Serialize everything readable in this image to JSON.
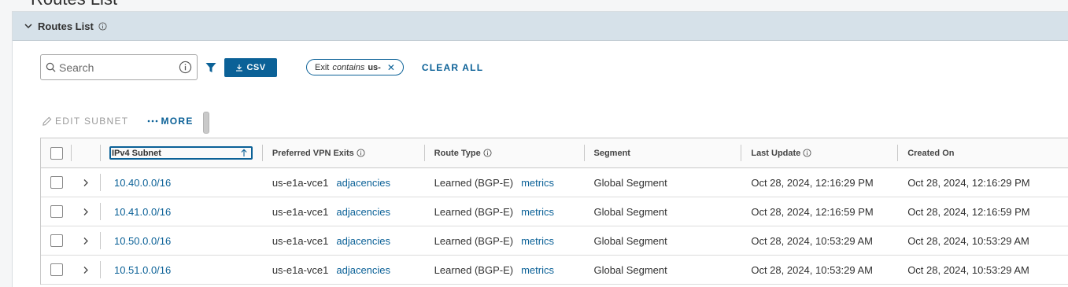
{
  "page": {
    "title": "Routes List"
  },
  "panel": {
    "title": "Routes List"
  },
  "toolbar": {
    "search_placeholder": "Search",
    "csv_label": "CSV",
    "filter_chip": {
      "field": "Exit",
      "operator": "contains",
      "value": "us-"
    },
    "clear_all_label": "CLEAR ALL"
  },
  "actions": {
    "edit_subnet_label": "EDIT SUBNET",
    "more_label": "MORE"
  },
  "table": {
    "columns": {
      "subnet": "IPv4 Subnet",
      "vpn": "Preferred VPN Exits",
      "type": "Route Type",
      "segment": "Segment",
      "updated": "Last Update",
      "created": "Created On"
    },
    "rows": [
      {
        "subnet": "10.40.0.0/16",
        "vpn": "us-e1a-vce1",
        "vpn_link": "adjacencies",
        "type": "Learned (BGP-E)",
        "type_link": "metrics",
        "segment": "Global Segment",
        "updated": "Oct 28, 2024, 12:16:29 PM",
        "created": "Oct 28, 2024, 12:16:29 PM"
      },
      {
        "subnet": "10.41.0.0/16",
        "vpn": "us-e1a-vce1",
        "vpn_link": "adjacencies",
        "type": "Learned (BGP-E)",
        "type_link": "metrics",
        "segment": "Global Segment",
        "updated": "Oct 28, 2024, 12:16:59 PM",
        "created": "Oct 28, 2024, 12:16:59 PM"
      },
      {
        "subnet": "10.50.0.0/16",
        "vpn": "us-e1a-vce1",
        "vpn_link": "adjacencies",
        "type": "Learned (BGP-E)",
        "type_link": "metrics",
        "segment": "Global Segment",
        "updated": "Oct 28, 2024, 10:53:29 AM",
        "created": "Oct 28, 2024, 10:53:29 AM"
      },
      {
        "subnet": "10.51.0.0/16",
        "vpn": "us-e1a-vce1",
        "vpn_link": "adjacencies",
        "type": "Learned (BGP-E)",
        "type_link": "metrics",
        "segment": "Global Segment",
        "updated": "Oct 28, 2024, 10:53:29 AM",
        "created": "Oct 28, 2024, 10:53:29 AM"
      }
    ]
  },
  "colors": {
    "accent": "#0b6197",
    "header_bg": "#d6e1e9"
  },
  "icons": [
    "chevron-down-icon",
    "info-icon",
    "search-icon",
    "filter-icon",
    "download-icon",
    "close-icon",
    "pencil-icon",
    "ellipsis-icon",
    "chevron-right-icon",
    "sort-ascending-icon"
  ]
}
